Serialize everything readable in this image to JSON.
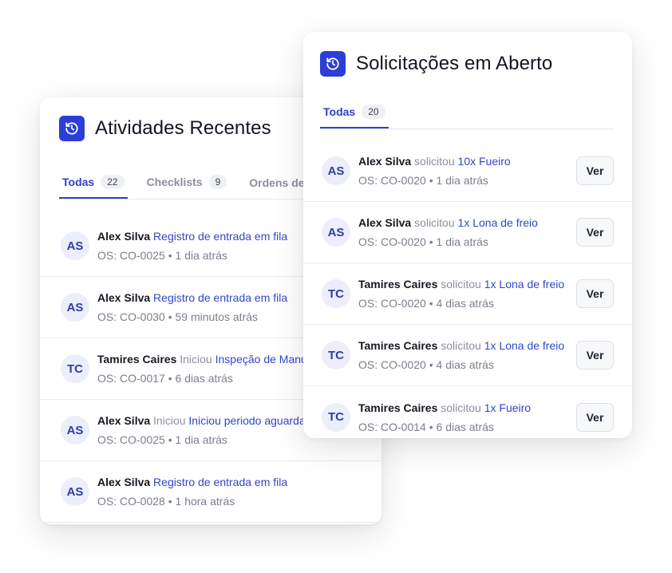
{
  "activities": {
    "title": "Atividades Recentes",
    "icon": "history-icon",
    "accent": "#2b3ed8",
    "tabs": [
      {
        "label": "Todas",
        "count": "22",
        "active": true
      },
      {
        "label": "Checklists",
        "count": "9",
        "active": false
      },
      {
        "label": "Ordens de S",
        "count": "",
        "active": false
      }
    ],
    "items": [
      {
        "initials": "AS",
        "name": "Alex Silva",
        "verb": "",
        "action": "Registro de entrada em fila",
        "os": "OS: CO-0025",
        "time": "1 dia atrás"
      },
      {
        "initials": "AS",
        "name": "Alex Silva",
        "verb": "",
        "action": "Registro de entrada em fila",
        "os": "OS: CO-0030",
        "time": "59 minutos atrás"
      },
      {
        "initials": "TC",
        "name": "Tamires Caires",
        "verb": "Iniciou",
        "action": "Inspeção de Manut",
        "os": "OS: CO-0017",
        "time": "6 dias atrás"
      },
      {
        "initials": "AS",
        "name": "Alex Silva",
        "verb": "Iniciou",
        "action": "Iniciou periodo aguarda",
        "os": "OS: CO-0025",
        "time": "1 dia atrás"
      },
      {
        "initials": "AS",
        "name": "Alex Silva",
        "verb": "",
        "action": "Registro de entrada em fila",
        "os": "OS: CO-0028",
        "time": "1 hora atrás"
      }
    ]
  },
  "requests": {
    "title": "Solicitações em Aberto",
    "icon": "history-icon",
    "tabs": [
      {
        "label": "Todas",
        "count": "20",
        "active": true
      }
    ],
    "button_label": "Ver",
    "items": [
      {
        "initials": "AS",
        "name": "Alex Silva",
        "verb": "solicitou",
        "item": "10x Fueiro",
        "os": "OS: CO-0020",
        "time": "1 dia atrás"
      },
      {
        "initials": "AS",
        "name": "Alex Silva",
        "verb": "solicitou",
        "item": "1x Lona de freio",
        "os": "OS: CO-0020",
        "time": "1 dia atrás"
      },
      {
        "initials": "TC",
        "name": "Tamires Caires",
        "verb": "solicitou",
        "item": "1x Lona de freio",
        "os": "OS: CO-0020",
        "time": "4 dias atrás"
      },
      {
        "initials": "TC",
        "name": "Tamires Caires",
        "verb": "solicitou",
        "item": "1x Lona de freio",
        "os": "OS: CO-0020",
        "time": "4 dias atrás"
      },
      {
        "initials": "TC",
        "name": "Tamires Caires",
        "verb": "solicitou",
        "item": "1x Fueiro",
        "os": "OS: CO-0014",
        "time": "6 dias atrás"
      }
    ]
  }
}
